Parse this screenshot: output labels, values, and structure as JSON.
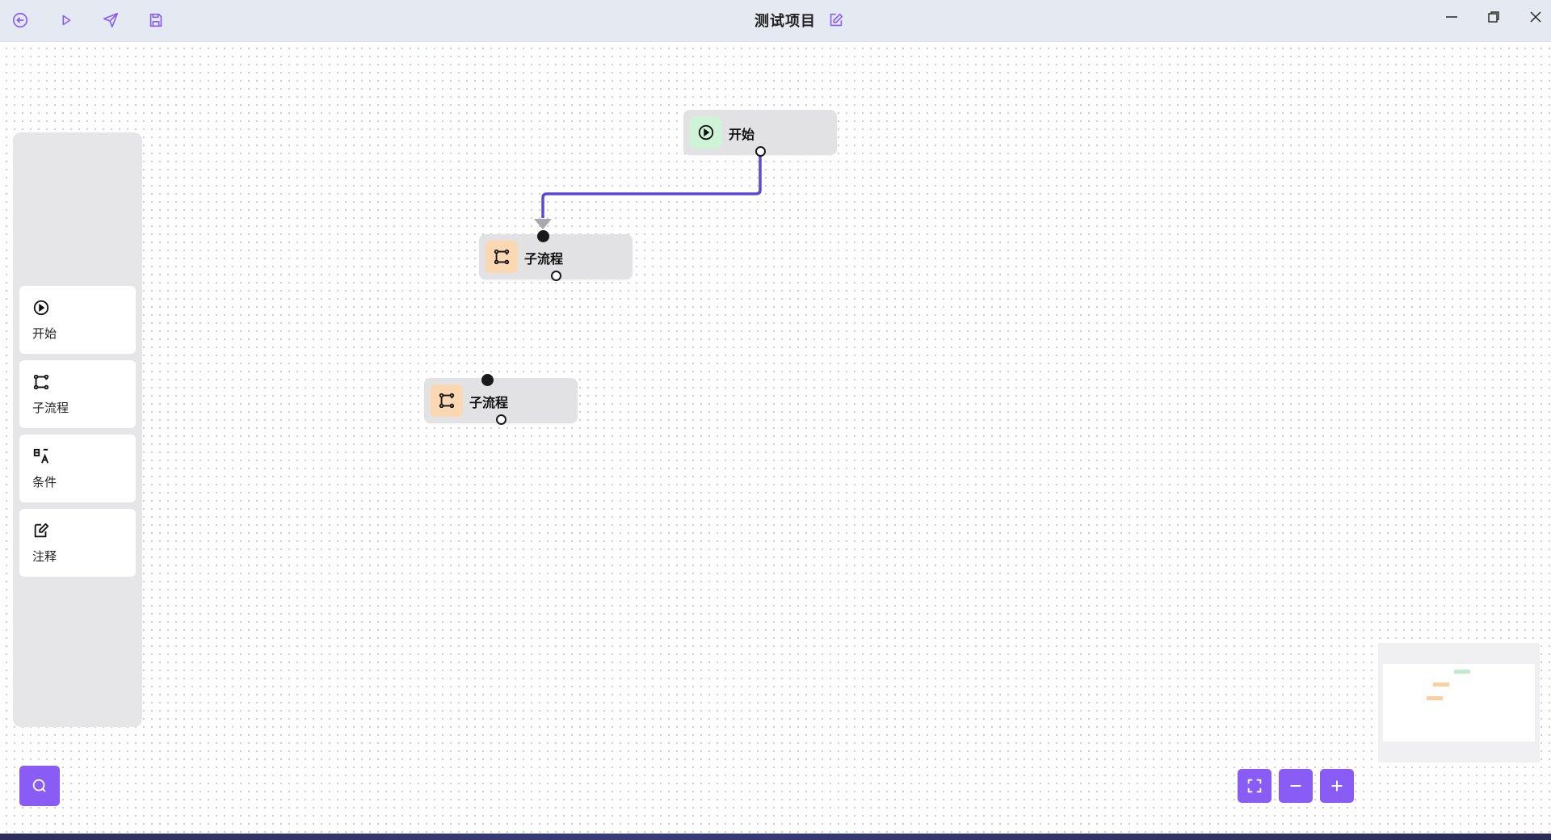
{
  "toolbar": {
    "back_icon": "back-circle-icon",
    "run_icon": "play-icon",
    "publish_icon": "send-icon",
    "save_icon": "save-icon"
  },
  "project": {
    "title": "测试项目",
    "edit_icon": "edit-icon"
  },
  "window_controls": [
    "minimize-icon",
    "restore-icon",
    "close-icon"
  ],
  "palette": {
    "items": [
      {
        "label": "开始",
        "icon": "play-circle-icon"
      },
      {
        "label": "子流程",
        "icon": "subflow-icon"
      },
      {
        "label": "条件",
        "icon": "condition-icon"
      },
      {
        "label": "注释",
        "icon": "note-icon"
      }
    ]
  },
  "flow": {
    "nodes": [
      {
        "id": "start",
        "label": "开始",
        "type": "start",
        "color": "#cff3d7"
      },
      {
        "id": "sub1",
        "label": "子流程",
        "type": "subflow",
        "color": "#fbd8b1"
      },
      {
        "id": "sub2",
        "label": "子流程",
        "type": "subflow",
        "color": "#fbd8b1"
      }
    ],
    "edges": [
      {
        "from": "start",
        "to": "sub1",
        "color": "#5a48d6"
      }
    ]
  },
  "controls": {
    "search_icon": "search-icon",
    "fit_icon": "fit-view-icon",
    "zoom_out_icon": "zoom-out-icon",
    "zoom_in_icon": "zoom-in-icon",
    "accent": "#8a5cf6"
  }
}
